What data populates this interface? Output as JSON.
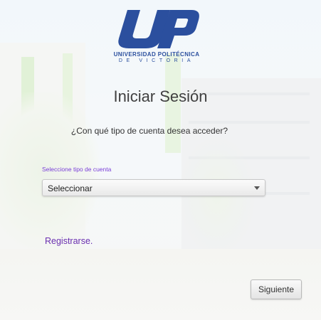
{
  "logo": {
    "university_name": "UNIVERSIDAD POLITÉCNICA",
    "location": "DE VICTORIA",
    "brand_color": "#2b4f9e"
  },
  "login": {
    "title": "Iniciar Sesión",
    "question": "¿Con qué tipo de cuenta desea acceder?",
    "account_type_label": "Seleccione tipo de cuenta",
    "account_type_value": "Seleccionar",
    "register_link": "Registrarse.",
    "next_button": "Siguiente"
  },
  "colors": {
    "label_purple": "#7a3fd8",
    "link_purple": "#6a2fb0"
  },
  "icons": {
    "select_caret": "chevron-down-icon"
  }
}
